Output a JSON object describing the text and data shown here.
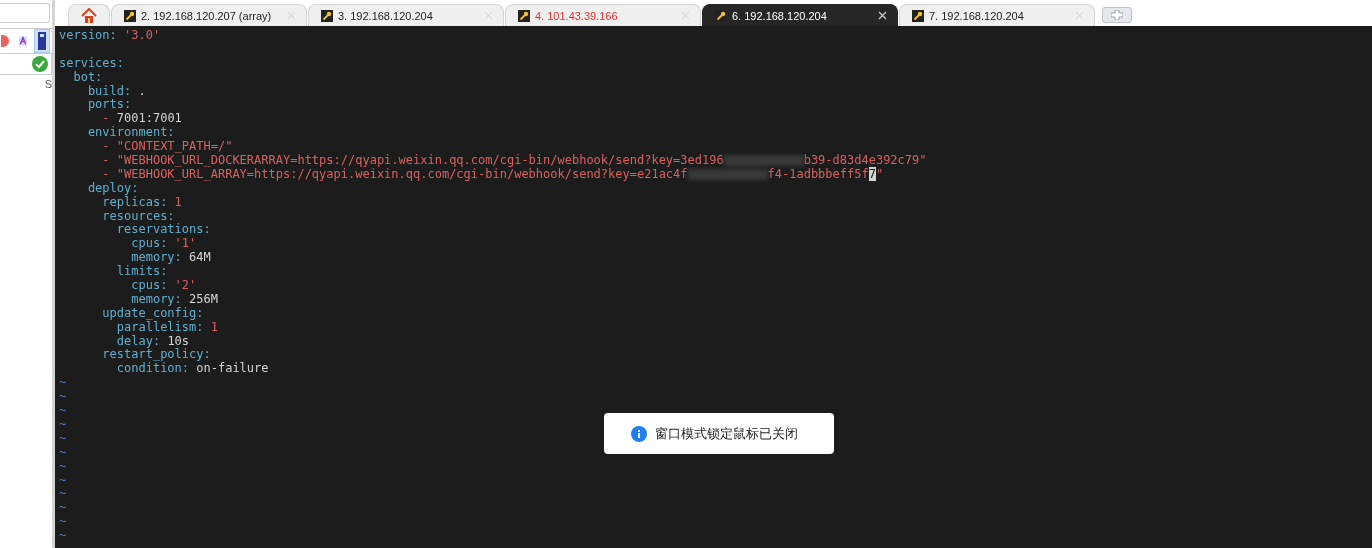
{
  "sidebar": {
    "toolbar": [
      {
        "kind": "record",
        "selected": false
      },
      {
        "kind": "font",
        "selected": false
      },
      {
        "kind": "panel",
        "selected": true
      }
    ],
    "status_ok": true,
    "partial_text": "S"
  },
  "tabs": [
    {
      "kind": "home",
      "selected": false
    },
    {
      "kind": "session",
      "label": "2. 192.168.120.207 (array)",
      "selected": false,
      "color": "#222222"
    },
    {
      "kind": "session",
      "label": "3. 192.168.120.204",
      "selected": false,
      "color": "#222222"
    },
    {
      "kind": "session",
      "label": "4. 101.43.39.166",
      "selected": false,
      "color": "#e03030"
    },
    {
      "kind": "session",
      "label": "6. 192.168.120.204",
      "selected": true,
      "color": "#ffffff"
    },
    {
      "kind": "session",
      "label": "7. 192.168.120.204",
      "selected": false,
      "color": "#222222"
    }
  ],
  "terminal": {
    "lines": [
      [
        {
          "kind": "key",
          "text": "version:"
        },
        {
          "kind": "str",
          "text": " '3.0'"
        }
      ],
      [
        {
          "kind": "blank"
        }
      ],
      [
        {
          "kind": "key",
          "text": "services:"
        }
      ],
      [
        {
          "kind": "key",
          "text": "  bot:"
        }
      ],
      [
        {
          "kind": "key",
          "text": "    build:"
        },
        {
          "kind": "plain",
          "text": " ."
        }
      ],
      [
        {
          "kind": "key",
          "text": "    ports:"
        }
      ],
      [
        {
          "kind": "str",
          "text": "      -"
        },
        {
          "kind": "plain",
          "text": " 7001:7001"
        }
      ],
      [
        {
          "kind": "key",
          "text": "    environment:"
        }
      ],
      [
        {
          "kind": "str",
          "text": "      - \"CONTEXT_PATH=/\""
        }
      ],
      [
        {
          "kind": "str",
          "text": "      - \"WEBHOOK_URL_DOCKERARRAY=https://qyapi.weixin.qq.com/cgi-bin/webhook/send?key=3ed196"
        },
        {
          "kind": "redacted"
        },
        {
          "kind": "str",
          "text": "b39-d83d4e392c79\""
        }
      ],
      [
        {
          "kind": "str",
          "text": "      - \"WEBHOOK_URL_ARRAY=https://qyapi.weixin.qq.com/cgi-bin/webhook/send?key=e21ac4f"
        },
        {
          "kind": "redacted"
        },
        {
          "kind": "str",
          "text": "f4-1adbbbeff5f"
        },
        {
          "kind": "cursor",
          "text": "7"
        },
        {
          "kind": "str",
          "text": "\""
        }
      ],
      [
        {
          "kind": "key",
          "text": "    deploy:"
        }
      ],
      [
        {
          "kind": "key",
          "text": "      replicas:"
        },
        {
          "kind": "str",
          "text": " 1"
        }
      ],
      [
        {
          "kind": "key",
          "text": "      resources:"
        }
      ],
      [
        {
          "kind": "key",
          "text": "        reservations:"
        }
      ],
      [
        {
          "kind": "key",
          "text": "          cpus:"
        },
        {
          "kind": "str",
          "text": " '1'"
        }
      ],
      [
        {
          "kind": "key",
          "text": "          memory:"
        },
        {
          "kind": "plain",
          "text": " 64M"
        }
      ],
      [
        {
          "kind": "key",
          "text": "        limits:"
        }
      ],
      [
        {
          "kind": "key",
          "text": "          cpus:"
        },
        {
          "kind": "str",
          "text": " '2'"
        }
      ],
      [
        {
          "kind": "key",
          "text": "          memory:"
        },
        {
          "kind": "plain",
          "text": " 256M"
        }
      ],
      [
        {
          "kind": "key",
          "text": "      update_config:"
        }
      ],
      [
        {
          "kind": "key",
          "text": "        parallelism:"
        },
        {
          "kind": "str",
          "text": " 1"
        }
      ],
      [
        {
          "kind": "key",
          "text": "        delay:"
        },
        {
          "kind": "plain",
          "text": " 10s"
        }
      ],
      [
        {
          "kind": "key",
          "text": "      restart_policy:"
        }
      ],
      [
        {
          "kind": "key",
          "text": "        condition:"
        },
        {
          "kind": "plain",
          "text": " on-failure"
        }
      ]
    ],
    "empty_lines": [
      "~",
      "~",
      "~",
      "~",
      "~",
      "~",
      "~",
      "~",
      "~",
      "~",
      "~",
      "~"
    ]
  },
  "toast": {
    "kind": "info",
    "text": "窗口模式锁定鼠标已关闭"
  }
}
